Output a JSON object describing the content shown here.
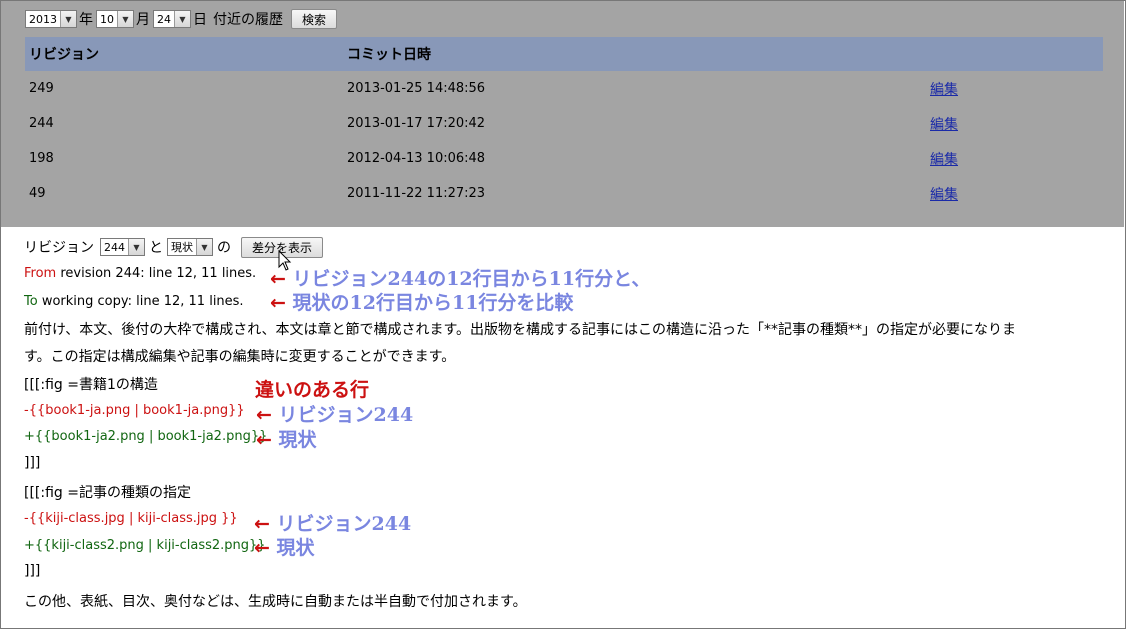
{
  "history": {
    "year": "2013",
    "year_unit": "年",
    "month": "10",
    "month_unit": "月",
    "day": "24",
    "day_unit": "日",
    "suffix": "付近の履歴",
    "search_button": "検索",
    "table": {
      "headers": [
        "リビジョン",
        "コミット日時",
        ""
      ],
      "rows": [
        {
          "revision": "249",
          "date": "2013-01-25 14:48:56",
          "action": "編集"
        },
        {
          "revision": "244",
          "date": "2013-01-17 17:20:42",
          "action": "編集"
        },
        {
          "revision": "198",
          "date": "2012-04-13 10:06:48",
          "action": "編集"
        },
        {
          "revision": "49",
          "date": "2011-11-22 11:27:23",
          "action": "編集"
        }
      ]
    }
  },
  "diff": {
    "label": "リビジョン",
    "rev_select": "244",
    "to": "と",
    "current_select": "現状",
    "of": "の",
    "show_button": "差分を表示",
    "from_label": "From",
    "from_rest": " revision 244: line 12, 11 lines.",
    "to_label": "To",
    "to_rest": " working copy: line 12, 11 lines.",
    "para1": "前付け、本文、後付の大枠で構成され、本文は章と節で構成されます。出版物を構成する記事にはこの構造に沿った「**記事の種類**」の指定が必要になりま",
    "para2": "す。この指定は構成編集や記事の編集時に変更することができます。",
    "fig1_open": "[[[:fig =書籍1の構造",
    "fig1_old": "-{{book1-ja.png | book1-ja.png}}",
    "fig1_new": "+{{book1-ja2.png | book1-ja2.png}}",
    "close1": "]]]",
    "fig2_open": "[[[:fig =記事の種類の指定",
    "fig2_old": "-{{kiji-class.jpg | kiji-class.jpg }}",
    "fig2_new": "+{{kiji-class2.png | kiji-class2.png}}",
    "close2": "]]]",
    "para3": "この他、表紙、目次、奥付などは、生成時に自動または半自動で付加されます。"
  },
  "annotations": {
    "a1": "リビジョン244の12行目から11行分と、",
    "a2": "現状の12行目から11行分を比較",
    "diff_lines": "違いのある行",
    "rev": "リビジョン244",
    "current": "現状",
    "arrow": "←"
  },
  "colors": {
    "removed": "#cc1111",
    "added": "#116611",
    "annotation": "#7a86e0",
    "table_header": "#8898b8",
    "overlay": "#a4a4a4"
  }
}
